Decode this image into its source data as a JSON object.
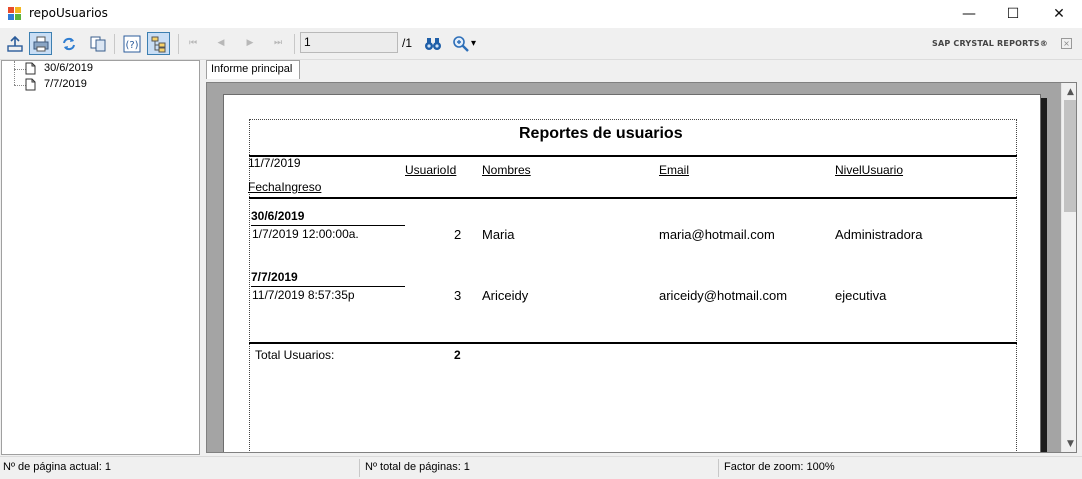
{
  "window": {
    "title": "repoUsuarios",
    "minimize": "—",
    "maximize": "☐",
    "close": "✕"
  },
  "toolbar": {
    "page_value": "1",
    "page_total": "/1",
    "brand": "SAP CRYSTAL REPORTS®",
    "brand_close": "×",
    "nav_first": "⏮",
    "nav_prev": "◀",
    "nav_next": "▶",
    "nav_last": "⏭",
    "zoom_caret": "▾"
  },
  "tree": {
    "items": [
      {
        "label": "30/6/2019"
      },
      {
        "label": "7/7/2019"
      }
    ]
  },
  "tab": {
    "label": "Informe principal"
  },
  "report": {
    "title": "Reportes de usuarios",
    "print_date": "11/7/2019",
    "columns": {
      "fecha": "FechaIngreso",
      "id": "UsuarioId",
      "nombres": "Nombres",
      "email": "Email",
      "nivel": "NivelUsuario"
    },
    "groups": [
      {
        "header": "30/6/2019",
        "fecha": "1/7/2019   12:00:00a.",
        "id": "2",
        "nombres": "Maria",
        "email": "maria@hotmail.com",
        "nivel": "Administradora"
      },
      {
        "header": "7/7/2019",
        "fecha": "11/7/2019    8:57:35p",
        "id": "3",
        "nombres": "Ariceidy",
        "email": "ariceidy@hotmail.com",
        "nivel": "ejecutiva"
      }
    ],
    "total_label": "Total Usuarios:",
    "total_value": "2"
  },
  "status": {
    "current_page": "Nº de página actual: 1",
    "total_pages": "Nº total de páginas: 1",
    "zoom": "Factor de zoom: 100%"
  },
  "scroll": {
    "up": "▲",
    "down": "▼"
  }
}
